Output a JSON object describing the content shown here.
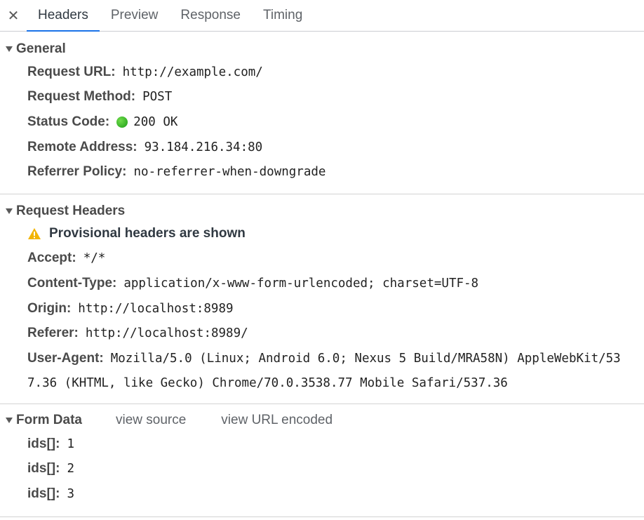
{
  "tabs": [
    {
      "label": "Headers",
      "active": true
    },
    {
      "label": "Preview"
    },
    {
      "label": "Response"
    },
    {
      "label": "Timing"
    }
  ],
  "close_icon": "close-icon",
  "general": {
    "title": "General",
    "rows": [
      {
        "key": "Request URL:",
        "value": "http://example.com/"
      },
      {
        "key": "Request Method:",
        "value": "POST"
      },
      {
        "key": "Status Code:",
        "value": "200 OK",
        "status_color": "#1c9c17"
      },
      {
        "key": "Remote Address:",
        "value": "93.184.216.34:80"
      },
      {
        "key": "Referrer Policy:",
        "value": "no-referrer-when-downgrade"
      }
    ]
  },
  "request_headers": {
    "title": "Request Headers",
    "warning": "Provisional headers are shown",
    "warning_color": "#f2b400",
    "rows": [
      {
        "key": "Accept:",
        "value": "*/*"
      },
      {
        "key": "Content-Type:",
        "value": "application/x-www-form-urlencoded; charset=UTF-8"
      },
      {
        "key": "Origin:",
        "value": "http://localhost:8989"
      },
      {
        "key": "Referer:",
        "value": "http://localhost:8989/"
      }
    ],
    "user_agent": {
      "key": "User-Agent:",
      "value_line1": "Mozilla/5.0 (Linux; Android 6.0; Nexus 5 Build/MRA58N) AppleWebKit/53",
      "value_line2": "7.36 (KHTML, like Gecko) Chrome/70.0.3538.77 Mobile Safari/537.36"
    }
  },
  "form_data": {
    "title": "Form Data",
    "view_source": "view source",
    "view_url_encoded": "view URL encoded",
    "rows": [
      {
        "key": "ids[]:",
        "value": "1"
      },
      {
        "key": "ids[]:",
        "value": "2"
      },
      {
        "key": "ids[]:",
        "value": "3"
      }
    ]
  }
}
